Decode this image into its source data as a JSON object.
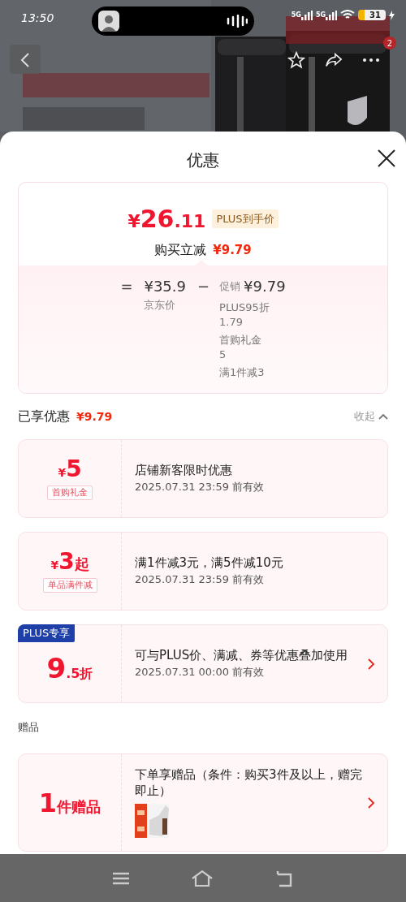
{
  "status_bar": {
    "time": "13:50",
    "signals": [
      "5G",
      "5G"
    ],
    "battery": "31"
  },
  "top_nav": {
    "badge": "2"
  },
  "sheet": {
    "title": "优惠"
  },
  "price_summary": {
    "currency": "¥",
    "integer": "26",
    "decimal": ".11",
    "tag": "PLUS到手价",
    "reduction_label": "购买立减",
    "reduction": "¥9.79",
    "breakdown": {
      "equals": "=",
      "base_price": "¥35.9",
      "base_label": "京东价",
      "minus": "−",
      "promo_label": "促销",
      "promo_amount": "¥9.79",
      "items": [
        {
          "name": "PLUS95折",
          "amount": "1.79"
        },
        {
          "name": "首购礼金",
          "amount": "5"
        },
        {
          "name": "满1件减3"
        }
      ]
    }
  },
  "enjoyed": {
    "label": "已享优惠",
    "amount": "¥9.79",
    "toggle": "收起",
    "expanded": true
  },
  "coupons": [
    {
      "kind": "amount",
      "currency": "¥",
      "value": "5",
      "tag": "首购礼金",
      "title": "店铺新客限时优惠",
      "validity": "2025.07.31 23:59 前有效",
      "has_arrow": false
    },
    {
      "kind": "amount",
      "currency": "¥",
      "value": "3",
      "suffix": "起",
      "tag": "单品满件减",
      "title": "满1件减3元，满5件减10元",
      "validity": "2025.07.31 23:59 前有效",
      "has_arrow": false
    },
    {
      "kind": "discount",
      "badge": "PLUS专享",
      "value": "9",
      "decimal": ".5",
      "suffix": "折",
      "title": "可与PLUS价、满减、券等优惠叠加使用",
      "validity": "2025.07.31 00:00 前有效",
      "has_arrow": true
    }
  ],
  "gifts": {
    "label": "赠品",
    "items": [
      {
        "count": "1",
        "unit": "件赠品",
        "title": "下单享赠品（条件：购买3件及以上，赠完即止）",
        "has_arrow": true
      }
    ]
  }
}
